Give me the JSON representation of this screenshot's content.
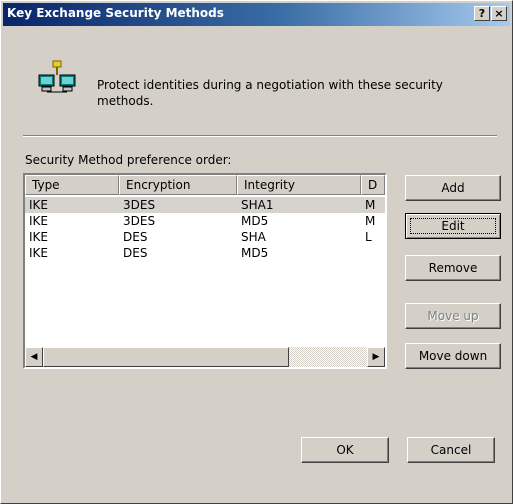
{
  "window": {
    "title": "Key Exchange Security Methods",
    "help_label": "?",
    "close_label": "×"
  },
  "intro": {
    "icon": "network-computers-key-icon",
    "text": "Protect identities during a negotiation with these security methods."
  },
  "list": {
    "caption_mnemonic": "Sec",
    "caption_prefix": "urity ",
    "caption_rest": "Method preference order:",
    "caption_plain": "Security Method preference order:",
    "columns": [
      "Type",
      "Encryption",
      "Integrity",
      "D"
    ],
    "rows": [
      {
        "type": "IKE",
        "encryption": "3DES",
        "integrity": "SHA1",
        "extra": "M",
        "selected": true
      },
      {
        "type": "IKE",
        "encryption": "3DES",
        "integrity": "MD5",
        "extra": "M",
        "selected": false
      },
      {
        "type": "IKE",
        "encryption": "DES",
        "integrity": "SHA",
        "extra": "L",
        "selected": false
      },
      {
        "type": "IKE",
        "encryption": "DES",
        "integrity": "MD5",
        "extra": "",
        "selected": false
      }
    ],
    "scroll_left": "◀",
    "scroll_right": "▶"
  },
  "buttons": {
    "add": "Add",
    "edit": "Edit",
    "remove": "Remove",
    "move_up": "Move up",
    "move_down": "Move down",
    "ok": "OK",
    "cancel": "Cancel"
  },
  "colors": {
    "title_gradient_start": "#0a246a",
    "title_gradient_end": "#a6caf0",
    "face": "#d4d0c8",
    "selected_row": "#d6d3ce"
  }
}
